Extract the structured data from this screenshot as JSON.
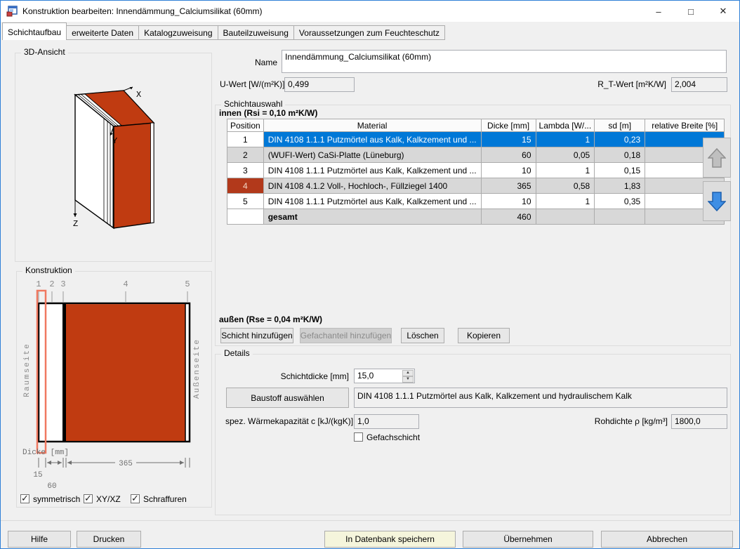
{
  "window": {
    "title": "Konstruktion bearbeiten: Innendämmung_Calciumsilikat (60mm)",
    "controls": {
      "minimize": "–",
      "maximize": "□",
      "close": "✕"
    }
  },
  "tabs": [
    {
      "label": "Schichtaufbau",
      "active": true
    },
    {
      "label": "erweiterte Daten",
      "active": false
    },
    {
      "label": "Katalogzuweisung",
      "active": false
    },
    {
      "label": "Bauteilzuweisung",
      "active": false
    },
    {
      "label": "Voraussetzungen zum Feuchteschutz",
      "active": false
    }
  ],
  "view3d": {
    "group_label": "3D-Ansicht",
    "axis_x": "X",
    "axis_y": "Y",
    "axis_z": "Z"
  },
  "konstruktion": {
    "group_label": "Konstruktion",
    "layer_numbers": [
      "1",
      "2",
      "3",
      "4",
      "5"
    ],
    "side_left": "Raumseite",
    "side_right": "Außenseite",
    "dicke_label": "Dicke [mm]",
    "dim_365": "365",
    "dim_15": "15",
    "dim_60": "60",
    "checkboxes": [
      {
        "label": "symmetrisch",
        "checked": true
      },
      {
        "label": "XY/XZ",
        "checked": true
      },
      {
        "label": "Schraffuren",
        "checked": true
      }
    ]
  },
  "form": {
    "name_label": "Name",
    "name_value": "Innendämmung_Calciumsilikat (60mm)",
    "u_wert_label": "U-Wert [W/(m²K)]",
    "u_wert_value": "0,499",
    "rt_wert_label": "R_T-Wert [m²K/W]",
    "rt_wert_value": "2,004"
  },
  "schichtauswahl": {
    "group_label": "Schichtauswahl",
    "innen_label": "innen (Rsi = 0,10 m²K/W)",
    "aussen_label": "außen (Rse = 0,04 m²K/W)",
    "table": {
      "headers": [
        "Position",
        "Material",
        "Dicke [mm]",
        "Lambda [W/...",
        "sd [m]",
        "relative Breite [%]"
      ],
      "rows": [
        {
          "position": "1",
          "material": "DIN 4108 1.1.1 Putzmörtel aus Kalk, Kalkzement und ...",
          "dicke": "15",
          "lambda": "1",
          "sd": "0,23",
          "breite": "",
          "selected": true,
          "position_highlight": false
        },
        {
          "position": "2",
          "material": "(WUFI-Wert) CaSi-Platte (Lüneburg)",
          "dicke": "60",
          "lambda": "0,05",
          "sd": "0,18",
          "breite": "",
          "selected": false,
          "position_highlight": false
        },
        {
          "position": "3",
          "material": "DIN 4108 1.1.1 Putzmörtel aus Kalk, Kalkzement und ...",
          "dicke": "10",
          "lambda": "1",
          "sd": "0,15",
          "breite": "",
          "selected": false,
          "position_highlight": false
        },
        {
          "position": "4",
          "material": "DIN 4108 4.1.2 Voll-, Hochloch-, Füllziegel 1400",
          "dicke": "365",
          "lambda": "0,58",
          "sd": "1,83",
          "breite": "",
          "selected": false,
          "position_highlight": true
        },
        {
          "position": "5",
          "material": "DIN 4108 1.1.1 Putzmörtel aus Kalk, Kalkzement und ...",
          "dicke": "10",
          "lambda": "1",
          "sd": "0,35",
          "breite": "",
          "selected": false,
          "position_highlight": false
        }
      ],
      "total_row": {
        "label": "gesamt",
        "dicke": "460"
      }
    },
    "buttons": {
      "add_layer": "Schicht hinzufügen",
      "add_gefach": "Gefachanteil hinzufügen",
      "delete": "Löschen",
      "copy": "Kopieren"
    }
  },
  "details": {
    "group_label": "Details",
    "schichtdicke_label": "Schichtdicke [mm]",
    "schichtdicke_value": "15,0",
    "baustoff_button": "Baustoff auswählen",
    "material_value": "DIN 4108 1.1.1 Putzmörtel aus Kalk, Kalkzement und  hydraulischem Kalk",
    "waermekapazitaet_label": "spez. Wärmekapazität c [kJ/(kgK)]",
    "waermekapazitaet_value": "1,0",
    "rohdichte_label": "Rohdichte ρ [kg/m³]",
    "rohdichte_value": "1800,0",
    "gefachschicht_label": "Gefachschicht",
    "gefachschicht_checked": false
  },
  "footer": {
    "hilfe": "Hilfe",
    "drucken": "Drucken",
    "speichern": "In Datenbank speichern",
    "uebernehmen": "Übernehmen",
    "abbrechen": "Abbrechen"
  },
  "colors": {
    "window_border": "#2F80D7",
    "selection_blue": "#0078D7",
    "brick_red": "#C03B11",
    "position_highlight_red": "#B2391B",
    "position_highlight_text": "#F2D4C2",
    "highlight_outline": "#F07860",
    "save_button_bg": "#F5F5DC",
    "drawing_gray": "#8A8A8A"
  }
}
